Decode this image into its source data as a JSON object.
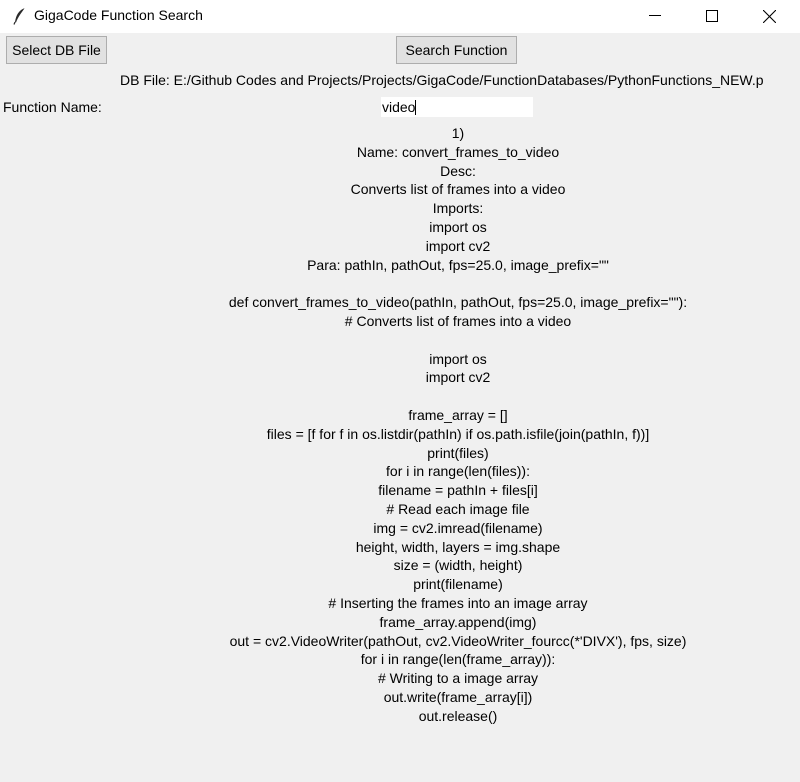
{
  "window": {
    "title": "GigaCode Function Search",
    "icon": "feather-icon"
  },
  "toolbar": {
    "select_db_label": "Select DB File",
    "search_label": "Search Function"
  },
  "db_file_text": "DB File: E:/Github Codes and Projects/Projects/GigaCode/FunctionDatabases/PythonFunctions_NEW.p",
  "function_name_label": "Function Name:",
  "search_input_value": "video",
  "results": {
    "lines": [
      "1)",
      "Name: convert_frames_to_video",
      "Desc:",
      "Converts list of frames into a video",
      "Imports:",
      "import os",
      "import cv2",
      "Para: pathIn, pathOut, fps=25.0, image_prefix=\"\"",
      "",
      "def convert_frames_to_video(pathIn, pathOut, fps=25.0, image_prefix=\"\"):",
      "# Converts list of frames into a video",
      "",
      "import os",
      "import cv2",
      "",
      "frame_array = []",
      "files = [f for f in os.listdir(pathIn) if os.path.isfile(join(pathIn, f))]",
      "print(files)",
      "for i in range(len(files)):",
      "filename = pathIn + files[i]",
      "# Read each image file",
      "img = cv2.imread(filename)",
      "height, width, layers = img.shape",
      "size = (width, height)",
      "print(filename)",
      "# Inserting the frames into an image array",
      "frame_array.append(img)",
      "out = cv2.VideoWriter(pathOut, cv2.VideoWriter_fourcc(*'DIVX'), fps, size)",
      "for i in range(len(frame_array)):",
      "# Writing to a image array",
      "out.write(frame_array[i])",
      "out.release()"
    ]
  }
}
